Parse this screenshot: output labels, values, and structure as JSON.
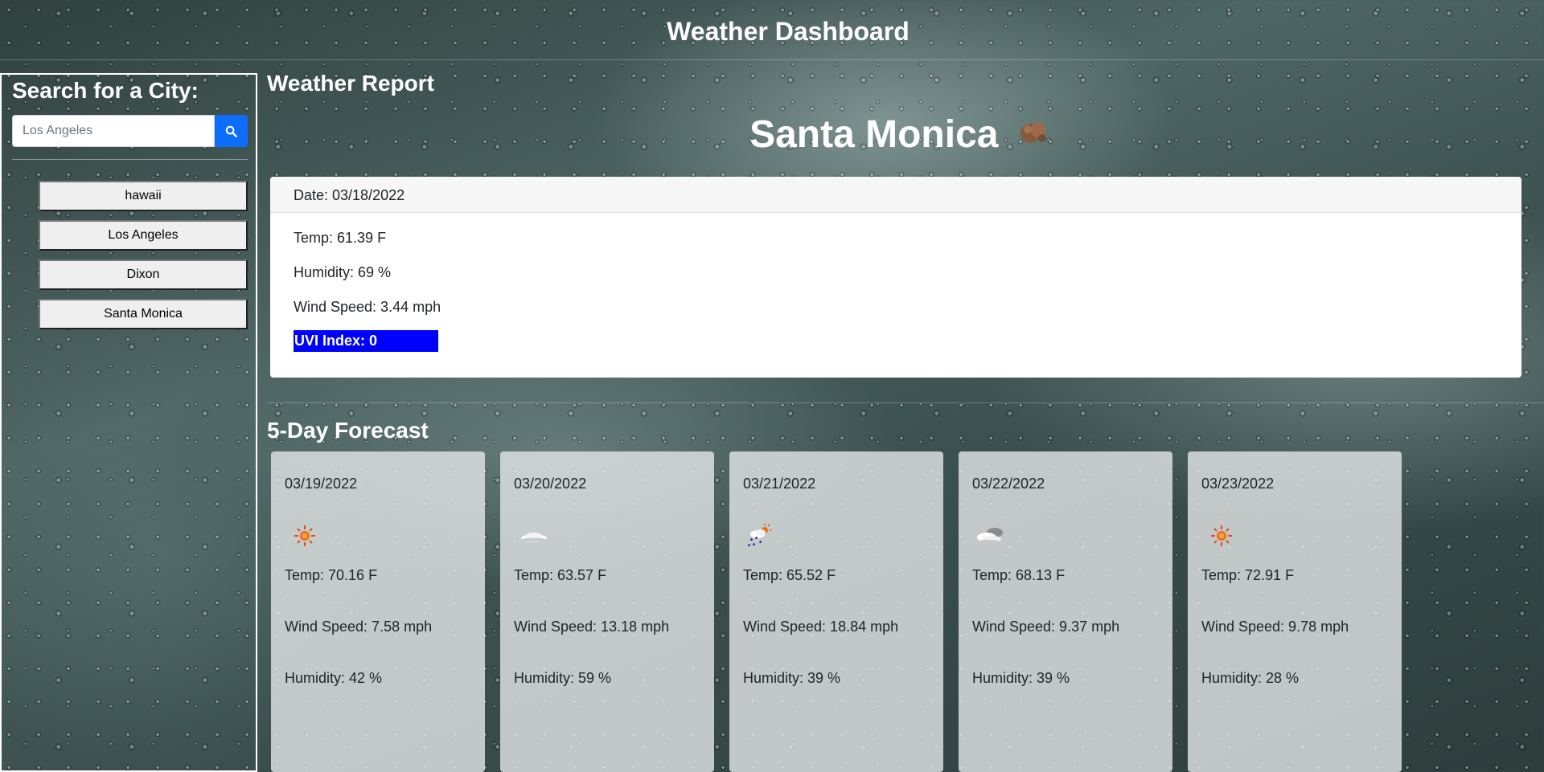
{
  "header": {
    "title": "Weather Dashboard"
  },
  "sidebar": {
    "heading": "Search for a City:",
    "search": {
      "placeholder": "Los Angeles",
      "button_icon": "search-icon"
    },
    "history": [
      "hawaii",
      "Los Angeles",
      "Dixon",
      "Santa Monica"
    ]
  },
  "report": {
    "title": "Weather Report",
    "city": "Santa Monica",
    "icon": "overcast-cloud-icon",
    "date": "Date: 03/18/2022",
    "temp": "Temp: 61.39 F",
    "humidity": "Humidity: 69 %",
    "wind": "Wind Speed: 3.44 mph",
    "uvi": "UVI Index: 0",
    "uvi_color": "#0000ff"
  },
  "forecast": {
    "title": "5-Day Forecast",
    "days": [
      {
        "date": "03/19/2022",
        "icon": "sun-icon",
        "temp": "Temp: 70.16 F",
        "wind": "Wind Speed: 7.58 mph",
        "humidity": "Humidity: 42 %"
      },
      {
        "date": "03/20/2022",
        "icon": "cloud-icon",
        "temp": "Temp: 63.57 F",
        "wind": "Wind Speed: 13.18 mph",
        "humidity": "Humidity: 59 %"
      },
      {
        "date": "03/21/2022",
        "icon": "rain-sun-icon",
        "temp": "Temp: 65.52 F",
        "wind": "Wind Speed: 18.84 mph",
        "humidity": "Humidity: 39 %"
      },
      {
        "date": "03/22/2022",
        "icon": "clouds-icon",
        "temp": "Temp: 68.13 F",
        "wind": "Wind Speed: 9.37 mph",
        "humidity": "Humidity: 39 %"
      },
      {
        "date": "03/23/2022",
        "icon": "sun-icon",
        "temp": "Temp: 72.91 F",
        "wind": "Wind Speed: 9.78 mph",
        "humidity": "Humidity: 28 %"
      }
    ]
  }
}
